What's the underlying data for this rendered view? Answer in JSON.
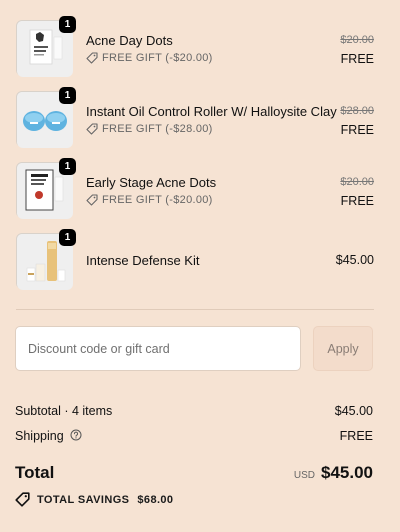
{
  "cart": {
    "items": [
      {
        "name": "Acne Day Dots",
        "quantity": "1",
        "gift_label": "FREE GIFT (-$20.00)",
        "original_price": "$20.00",
        "price": "FREE",
        "thumb": "acne-day-dots-thumbnail"
      },
      {
        "name": "Instant Oil Control Roller W/ Halloysite Clay",
        "quantity": "1",
        "gift_label": "FREE GIFT (-$28.00)",
        "original_price": "$28.00",
        "price": "FREE",
        "thumb": "oil-roller-thumbnail"
      },
      {
        "name": "Early Stage Acne Dots",
        "quantity": "1",
        "gift_label": "FREE GIFT (-$20.00)",
        "original_price": "$20.00",
        "price": "FREE",
        "thumb": "early-stage-dots-thumbnail"
      },
      {
        "name": "Intense Defense Kit",
        "quantity": "1",
        "price": "$45.00",
        "thumb": "defense-kit-thumbnail"
      }
    ]
  },
  "discount": {
    "placeholder": "Discount code or gift card",
    "apply_label": "Apply"
  },
  "summary": {
    "subtotal_label": "Subtotal · 4 items",
    "subtotal_value": "$45.00",
    "shipping_label": "Shipping",
    "shipping_value": "FREE",
    "total_label": "Total",
    "currency": "USD",
    "total_value": "$45.00",
    "savings_label": "TOTAL SAVINGS",
    "savings_value": "$68.00"
  },
  "colors": {
    "background": "#f6e3d3",
    "badge": "#000000",
    "apply_button": "#f3dccb"
  }
}
